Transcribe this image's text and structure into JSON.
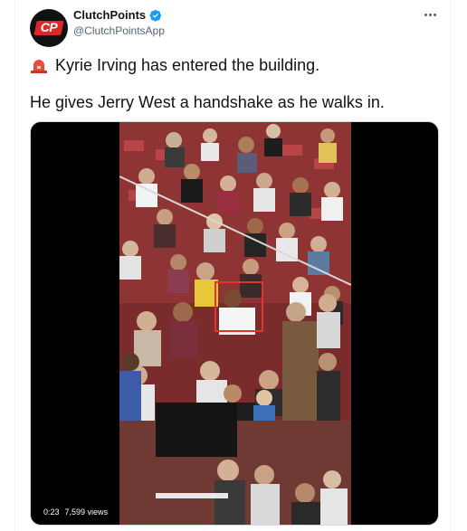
{
  "author": {
    "display_name": "ClutchPoints",
    "handle": "@ClutchPointsApp",
    "avatar_text": "CP",
    "verified": true
  },
  "tweet": {
    "line1": "Kyrie Irving has entered the building.",
    "line2": "He gives Jerry West a handshake as he walks in."
  },
  "video": {
    "time": "0:23",
    "views": "7,599 views"
  },
  "colors": {
    "brand_red": "#e0252b",
    "verified_blue": "#1d9bf0",
    "highlight_box": "#e5322b"
  }
}
